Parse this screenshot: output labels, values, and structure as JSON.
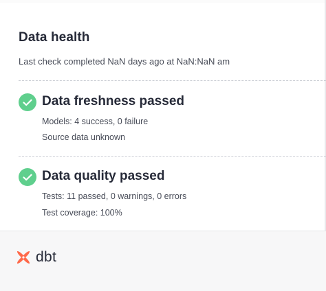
{
  "panel": {
    "title": "Data health",
    "last_check": "Last check completed NaN days ago at NaN:NaN am"
  },
  "freshness": {
    "status_icon": "check-circle-icon",
    "title": "Data freshness passed",
    "models": "Models: 4 success, 0 failure",
    "source": "Source data unknown"
  },
  "quality": {
    "status_icon": "check-circle-icon",
    "title": "Data quality passed",
    "tests": "Tests: 11 passed, 0 warnings, 0 errors",
    "coverage": "Test coverage: 100%"
  },
  "footer": {
    "logo_text": "dbt",
    "logo_icon": "dbt-logo-icon"
  },
  "colors": {
    "success": "#5fcf8d",
    "brand_orange": "#ff694a",
    "text_primary": "#262a38",
    "text_secondary": "#474b57"
  }
}
